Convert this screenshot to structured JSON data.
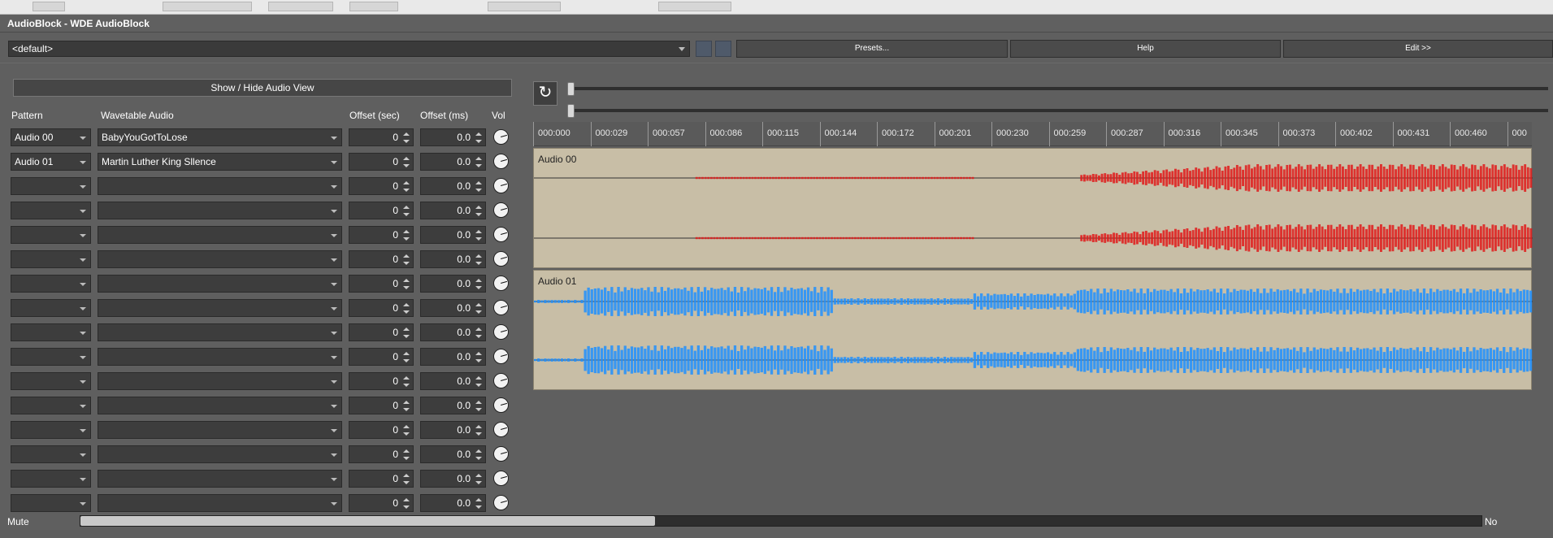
{
  "window": {
    "title": "AudioBlock - WDE AudioBlock"
  },
  "presets_bar": {
    "preset_value": "<default>",
    "presets_label": "Presets...",
    "help_label": "Help",
    "edit_label": "Edit >>"
  },
  "left": {
    "show_hide_label": "Show / Hide Audio View",
    "headers": {
      "pattern": "Pattern",
      "wavetable": "Wavetable Audio",
      "offset_sec": "Offset (sec)",
      "offset_ms": "Offset (ms)",
      "vol": "Vol"
    },
    "rows": [
      {
        "pattern": "Audio 00",
        "audio": "BabyYouGotToLose",
        "sec": "0",
        "ms": "0.0"
      },
      {
        "pattern": "Audio 01",
        "audio": "Martin Luther King Sllence",
        "sec": "0",
        "ms": "0.0"
      },
      {
        "pattern": "",
        "audio": "",
        "sec": "0",
        "ms": "0.0"
      },
      {
        "pattern": "",
        "audio": "",
        "sec": "0",
        "ms": "0.0"
      },
      {
        "pattern": "",
        "audio": "",
        "sec": "0",
        "ms": "0.0"
      },
      {
        "pattern": "",
        "audio": "",
        "sec": "0",
        "ms": "0.0"
      },
      {
        "pattern": "",
        "audio": "",
        "sec": "0",
        "ms": "0.0"
      },
      {
        "pattern": "",
        "audio": "",
        "sec": "0",
        "ms": "0.0"
      },
      {
        "pattern": "",
        "audio": "",
        "sec": "0",
        "ms": "0.0"
      },
      {
        "pattern": "",
        "audio": "",
        "sec": "0",
        "ms": "0.0"
      },
      {
        "pattern": "",
        "audio": "",
        "sec": "0",
        "ms": "0.0"
      },
      {
        "pattern": "",
        "audio": "",
        "sec": "0",
        "ms": "0.0"
      },
      {
        "pattern": "",
        "audio": "",
        "sec": "0",
        "ms": "0.0"
      },
      {
        "pattern": "",
        "audio": "",
        "sec": "0",
        "ms": "0.0"
      },
      {
        "pattern": "",
        "audio": "",
        "sec": "0",
        "ms": "0.0"
      },
      {
        "pattern": "",
        "audio": "",
        "sec": "0",
        "ms": "0.0"
      }
    ]
  },
  "footer": {
    "mute_label": "Mute",
    "no_label": "No",
    "scroll_fraction": 0.41
  },
  "timeline": {
    "ticks": [
      "000:000",
      "000:029",
      "000:057",
      "000:086",
      "000:115",
      "000:144",
      "000:172",
      "000:201",
      "000:230",
      "000:259",
      "000:287",
      "000:316",
      "000:345",
      "000:373",
      "000:402",
      "000:431",
      "000:460",
      "000"
    ],
    "refresh_icon": "↻"
  },
  "tracks": [
    {
      "name": "Audio 00",
      "color": "#e01a1a"
    },
    {
      "name": "Audio 01",
      "color": "#1e90ff"
    }
  ]
}
